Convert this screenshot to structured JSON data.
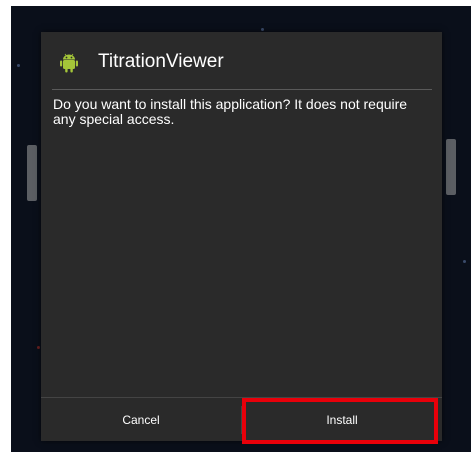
{
  "dialog": {
    "title": "TitrationViewer",
    "app_icon": "android-icon",
    "message": "Do you want to install this application? It does not require any special access.",
    "buttons": {
      "cancel_label": "Cancel",
      "install_label": "Install"
    }
  },
  "colors": {
    "dialog_background": "#2a2a2a",
    "screen_background": "#0a0f1a",
    "android_green": "#a4c639",
    "highlight": "#e8000a"
  }
}
